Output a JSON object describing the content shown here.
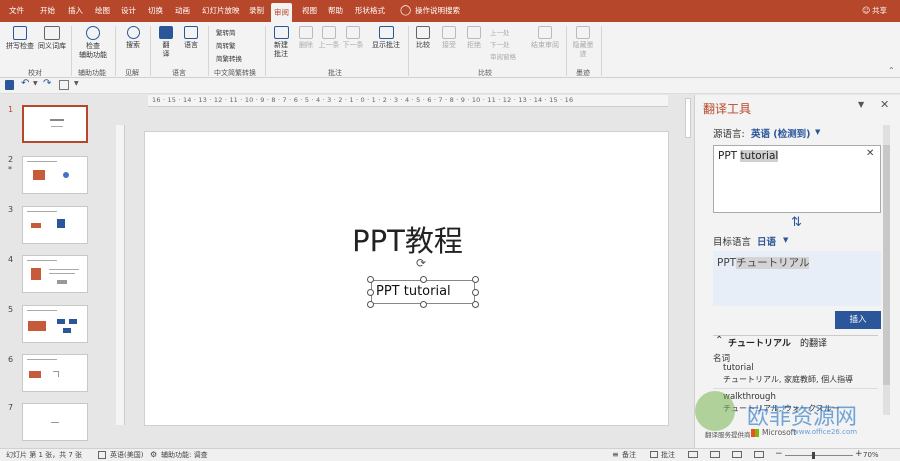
{
  "tabs": [
    "文件",
    "开始",
    "插入",
    "绘图",
    "设计",
    "切换",
    "动画",
    "幻灯片放映",
    "录制",
    "审阅",
    "视图",
    "帮助",
    "形状格式"
  ],
  "tell_me": "操作说明搜索",
  "share": "共享",
  "ribbon": {
    "proofing": {
      "spell": "拼写检查",
      "thesaurus": "同义词库",
      "label": "校对"
    },
    "accessibility": {
      "check": "检查\n辅助功能",
      "label": "辅助功能"
    },
    "insights": {
      "search": "搜索",
      "label": "见解"
    },
    "language": {
      "translate": "翻\n译",
      "lang": "语言",
      "label": "语言"
    },
    "chinese": {
      "to_trad": "繁转简",
      "to_simp": "简转繁",
      "convert": "简繁转换",
      "label": "中文简繁转换"
    },
    "comments": {
      "new": "新建\n批注",
      "delete": "删除",
      "prev": "上一条",
      "next": "下一条",
      "show": "显示批注",
      "label": "批注"
    },
    "compare": {
      "compare": "比较",
      "accept": "接受",
      "reject": "拒绝",
      "prev": "上一处",
      "next": "下一处",
      "pane": "审阅窗格",
      "end": "结束审阅",
      "label": "比较"
    },
    "ink": {
      "hide": "隐藏墨\n迹",
      "label": "墨迹"
    }
  },
  "slides": [
    {
      "num": "1",
      "selected": true
    },
    {
      "num": "2",
      "star": "*"
    },
    {
      "num": "3"
    },
    {
      "num": "4"
    },
    {
      "num": "5"
    },
    {
      "num": "6"
    },
    {
      "num": "7"
    }
  ],
  "ruler_labels": "16 · 15 · 14 · 13 · 12 · 11 · 10 · 9 · 8 · 7 · 6 · 5 · 4 · 3 · 2 · 1 · 0 · 1 · 2 · 3 · 4 · 5 · 6 · 7 · 8 · 9 · 10 · 11 · 12 · 13 · 14 · 15 · 16",
  "slide": {
    "title": "PPT教程",
    "subtitle": "PPT tutorial"
  },
  "translator": {
    "title": "翻译工具",
    "source_label": "源语言:",
    "source_lang": "英语 (检测到)",
    "source_text_a": "PPT ",
    "source_text_b": "tutorial",
    "target_label": "目标语言",
    "target_lang": "日语",
    "target_text_a": "PPT",
    "target_text_b": "チュートリアル",
    "insert": "插入",
    "heading_word": "チュートリアル",
    "heading_suffix": "的翻译",
    "pos": "名词",
    "entry1_word": "tutorial",
    "entry1_trans": "チュートリアル, 家庭教師, 個人指導",
    "entry2_word": "walkthrough",
    "entry2_trans": "チュートリアル, ウォークスルー",
    "footer_left": "翻译服务提供商",
    "footer_ms": "Microsoft"
  },
  "watermark": {
    "big": "欧菲资源网",
    "small": "www.office26.com"
  },
  "status": {
    "slide_of": "幻灯片 第 1 张，共 7 张",
    "lang": "英语(美国)",
    "accessibility": "辅助功能: 调查",
    "notes": "备注",
    "comments": "批注",
    "zoom": "70%"
  },
  "colors": {
    "accent": "#b7472a",
    "link": "#2b579a"
  }
}
